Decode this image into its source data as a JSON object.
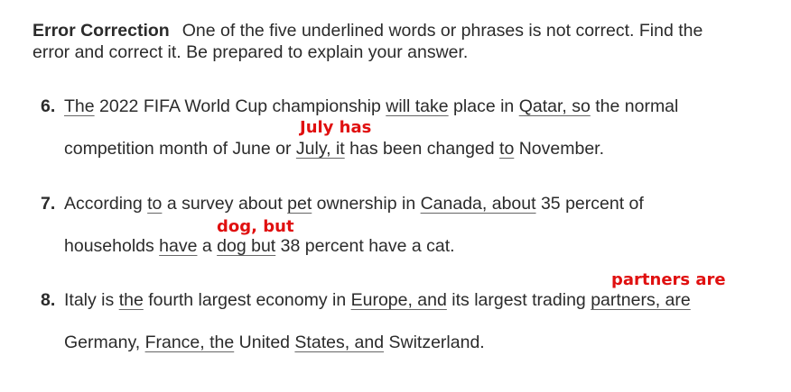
{
  "instructions": {
    "title": "Error Correction",
    "line1": "One of the five underlined words or phrases is not correct. Find the",
    "line2": "error and correct it. Be prepared to explain your answer."
  },
  "q6": {
    "number": "6.",
    "seg": [
      "The",
      " 2022 FIFA World Cup championship ",
      "will take",
      " place in ",
      "Qatar, so",
      " the normal"
    ],
    "seg2": [
      "competition month of June or ",
      "July, it",
      " has been changed ",
      "to",
      " November."
    ],
    "annotation": "July has"
  },
  "q7": {
    "number": "7.",
    "seg": [
      "According ",
      "to",
      " a survey about ",
      "pet",
      " ownership in ",
      "Canada, about",
      " 35 percent of"
    ],
    "seg2": [
      "households ",
      "have",
      " a ",
      "dog but",
      " 38 percent have a cat."
    ],
    "annotation": "dog, but"
  },
  "q8": {
    "number": "8.",
    "seg": [
      "Italy is ",
      "the",
      " fourth largest economy in ",
      "Europe, and",
      " its largest trading ",
      "partners, are"
    ],
    "seg2": [
      "Germany, ",
      "France, the",
      " United ",
      "States, and",
      " Switzerland."
    ],
    "annotation": "partners are"
  }
}
